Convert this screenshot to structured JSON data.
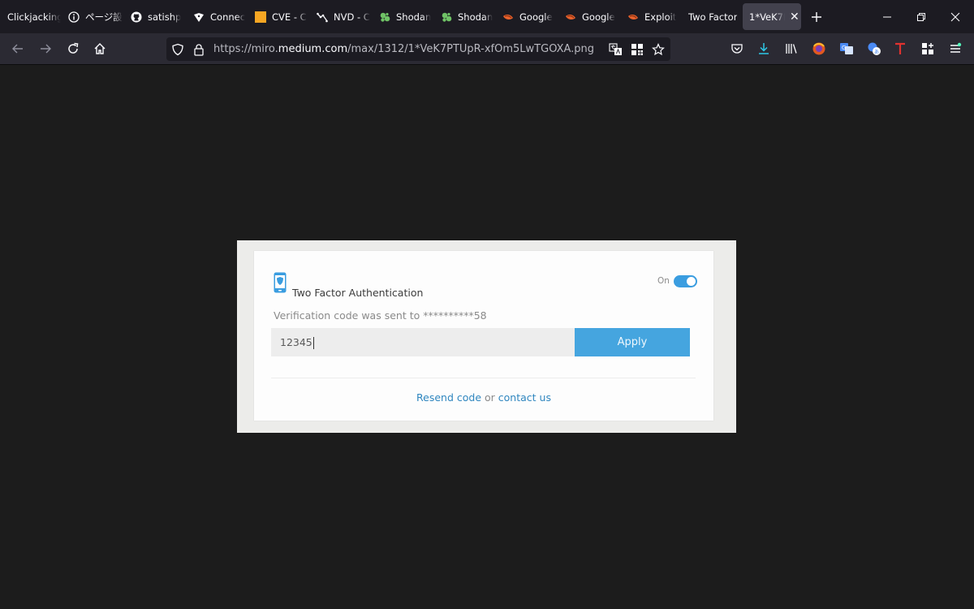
{
  "tabs": [
    {
      "label": "Clickjacking",
      "icon": "none"
    },
    {
      "label": "ページ設",
      "icon": "info-icon"
    },
    {
      "label": "satishp",
      "icon": "github-icon"
    },
    {
      "label": "Connec",
      "icon": "sheep-icon"
    },
    {
      "label": "CVE - C",
      "icon": "cve-icon"
    },
    {
      "label": "NVD - C",
      "icon": "nvd-icon"
    },
    {
      "label": "Shodan",
      "icon": "shodan-icon"
    },
    {
      "label": "Shodan",
      "icon": "shodan-icon"
    },
    {
      "label": "Google",
      "icon": "exploitdb-icon"
    },
    {
      "label": "Google",
      "icon": "exploitdb-icon"
    },
    {
      "label": "Exploit",
      "icon": "exploitdb-icon"
    },
    {
      "label": "Two Factor",
      "icon": "none"
    },
    {
      "label": "1*VeK7P",
      "icon": "none",
      "active": true
    }
  ],
  "url": {
    "prefix": "https://miro.",
    "host": "medium.com",
    "path": "/max/1312/1*VeK7PTUpR-xfOm5LwTGOXA.png"
  },
  "card": {
    "title": "Two Factor Authentication",
    "toggle_label": "On",
    "toggle_on": true,
    "sent_text": "Verification code was sent to **********58",
    "code_value": "12345",
    "apply_label": "Apply",
    "resend_link": "Resend code",
    "or_text": " or ",
    "contact_link": "contact us"
  },
  "colors": {
    "accent": "#45a5df",
    "link": "#2f86bf",
    "background": "#1c1c1c"
  }
}
